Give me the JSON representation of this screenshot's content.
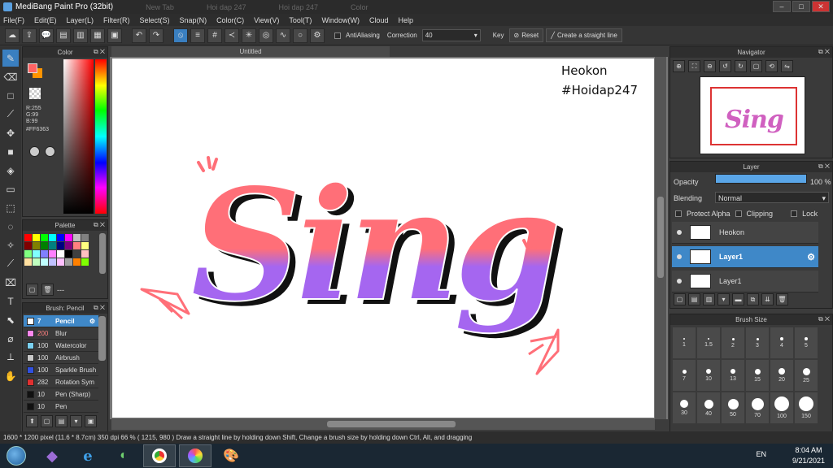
{
  "window": {
    "title": "MediBang Paint Pro (32bit)",
    "bg_tabs": [
      "New Tab",
      "Hoi dap 247",
      "Hoi dap 247",
      "Color"
    ]
  },
  "menu": [
    "File(F)",
    "Edit(E)",
    "Layer(L)",
    "Filter(R)",
    "Select(S)",
    "Snap(N)",
    "Color(C)",
    "View(V)",
    "Tool(T)",
    "Window(W)",
    "Cloud",
    "Help"
  ],
  "toolbar": {
    "antialiasing": "AntiAliasing",
    "correction_label": "Correction",
    "correction_value": "40",
    "key_label": "Key",
    "reset_label": "Reset",
    "straight_line_label": "Create a straight line"
  },
  "color_panel": {
    "title": "Color",
    "r": "R:255",
    "g": "G:99",
    "b": "B:99",
    "hex": "#FF6363",
    "fg": "#ff6363",
    "bg": "#ff9400"
  },
  "palette_panel": {
    "title": "Palette",
    "footer": "---",
    "colors": [
      "#ff0000",
      "#ffff00",
      "#00ff00",
      "#00ffff",
      "#0000ff",
      "#ff00ff",
      "#c0c0c0",
      "#808080",
      "#800000",
      "#808000",
      "#008000",
      "#008080",
      "#000080",
      "#800080",
      "#ff8080",
      "#ffff80",
      "#80ff80",
      "#80ffff",
      "#8080ff",
      "#ff80ff",
      "#ffffff",
      "#000000",
      "#404040",
      "#ffc0c0",
      "#ffe0a0",
      "#c0ffc0",
      "#c0ffff",
      "#c0c0ff",
      "#ffc0ff",
      "#a0a0a0",
      "#ff8000",
      "#80ff00"
    ]
  },
  "brush_panel": {
    "title": "Brush: Pencil",
    "brushes": [
      {
        "size": "7",
        "name": "Pencil",
        "color": "#ffffff"
      },
      {
        "size": "200",
        "name": "Blur",
        "color": "#ff88ee"
      },
      {
        "size": "100",
        "name": "Watercolor",
        "color": "#7ad0f0"
      },
      {
        "size": "100",
        "name": "Airbrush",
        "color": "#c8c8c8"
      },
      {
        "size": "100",
        "name": "Sparkle Brush",
        "color": "#3050e0"
      },
      {
        "size": "282",
        "name": "Rotation Sym",
        "color": "#e03030"
      },
      {
        "size": "10",
        "name": "Pen (Sharp)",
        "color": "#111111"
      },
      {
        "size": "10",
        "name": "Pen",
        "color": "#111111"
      }
    ]
  },
  "canvas": {
    "tab": "Untitled",
    "text_line1": "Heokon",
    "text_line2": "#Hoidap247",
    "lettering": "Sing"
  },
  "navigator": {
    "title": "Navigator"
  },
  "layer_panel": {
    "title": "Layer",
    "opacity_label": "Opacity",
    "opacity_value": "100 %",
    "blending_label": "Blending",
    "blending_value": "Normal",
    "protect_alpha": "Protect Alpha",
    "clipping": "Clipping",
    "lock": "Lock",
    "layers": [
      {
        "name": "Heokon",
        "selected": false
      },
      {
        "name": "Layer1",
        "selected": true
      },
      {
        "name": "Layer1",
        "selected": false
      }
    ]
  },
  "brush_size_panel": {
    "title": "Brush Size",
    "sizes": [
      "1",
      "1.5",
      "2",
      "3",
      "4",
      "5",
      "7",
      "10",
      "13",
      "15",
      "20",
      "25",
      "30",
      "40",
      "50",
      "70",
      "100",
      "150"
    ]
  },
  "status": {
    "text": "1600 * 1200 pixel  (11.6 * 8.7cm)  350 dpi  66 %  ( 1215, 980 )  Draw a straight line by holding down Shift, Change a brush size by holding down Ctrl, Alt, and dragging"
  },
  "taskbar": {
    "lang": "EN",
    "time": "8:04 AM",
    "date": "9/21/2021"
  }
}
